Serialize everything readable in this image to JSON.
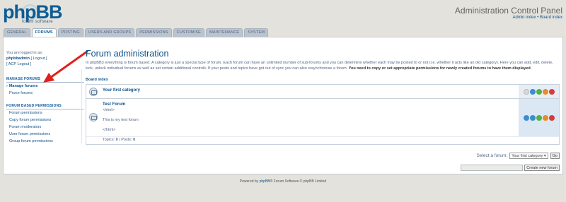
{
  "header": {
    "logo_text": "phpBB",
    "logo_sub": "forum software",
    "panel_title": "Administration Control Panel",
    "admin_index": "Admin index",
    "separator": " • ",
    "board_index": "Board index"
  },
  "tabs": [
    {
      "label": "GENERAL"
    },
    {
      "label": "FORUMS"
    },
    {
      "label": "POSTING"
    },
    {
      "label": "USERS AND GROUPS"
    },
    {
      "label": "PERMISSIONS"
    },
    {
      "label": "CUSTOMISE"
    },
    {
      "label": "MAINTENANCE"
    },
    {
      "label": "SYSTEM"
    }
  ],
  "sidebar": {
    "logged_in_as": "You are logged in as:",
    "username": "phpbbadmin",
    "logout": "[ Logout ]",
    "acp_logout": "[ ACP Logout ]",
    "sections": [
      {
        "heading": "MANAGE FORUMS",
        "items": [
          {
            "label": "Manage forums"
          },
          {
            "label": "Prune forums"
          }
        ]
      },
      {
        "heading": "FORUM BASED PERMISSIONS",
        "items": [
          {
            "label": "Forum permissions"
          },
          {
            "label": "Copy forum permissions"
          },
          {
            "label": "Forum moderators"
          },
          {
            "label": "User forum permissions"
          },
          {
            "label": "Group forum permissions"
          }
        ]
      }
    ]
  },
  "content": {
    "title": "Forum administration",
    "description": "In phpBB3 everything is forum based. A category is just a special type of forum. Each forum can have an unlimited number of sub-forums and you can determine whether each may be posted to or not (i.e. whether it acts like an old category). Here you can add, edit, delete, lock, unlock individual forums as well as set certain additional controls. If your posts and topics have got out of sync you can also resynchronise a forum.",
    "description_bold": "You need to copy or set appropriate permissions for newly created forums to have them displayed.",
    "breadcrumb": "Board index",
    "category": {
      "name": "Your first category"
    },
    "forum": {
      "name": "Test Forum",
      "line1": "<html>",
      "line2": "This is my test forum",
      "line3": "</html>",
      "topics_label": "Topics: ",
      "topics": "0",
      "posts_label": " / Posts: ",
      "posts": "0"
    },
    "select_label": "Select a forum:",
    "select_value": "Your first category",
    "go_button": "Go",
    "create_input_value": "",
    "create_button": "Create new forum"
  },
  "footer": {
    "powered_by": "Powered by ",
    "brand": "phpBB",
    "rest": "® Forum Software © phpBB Limited"
  },
  "colors": {
    "accent": "#105289",
    "arrow": "#e0201c",
    "background": "#e4e2dc"
  }
}
